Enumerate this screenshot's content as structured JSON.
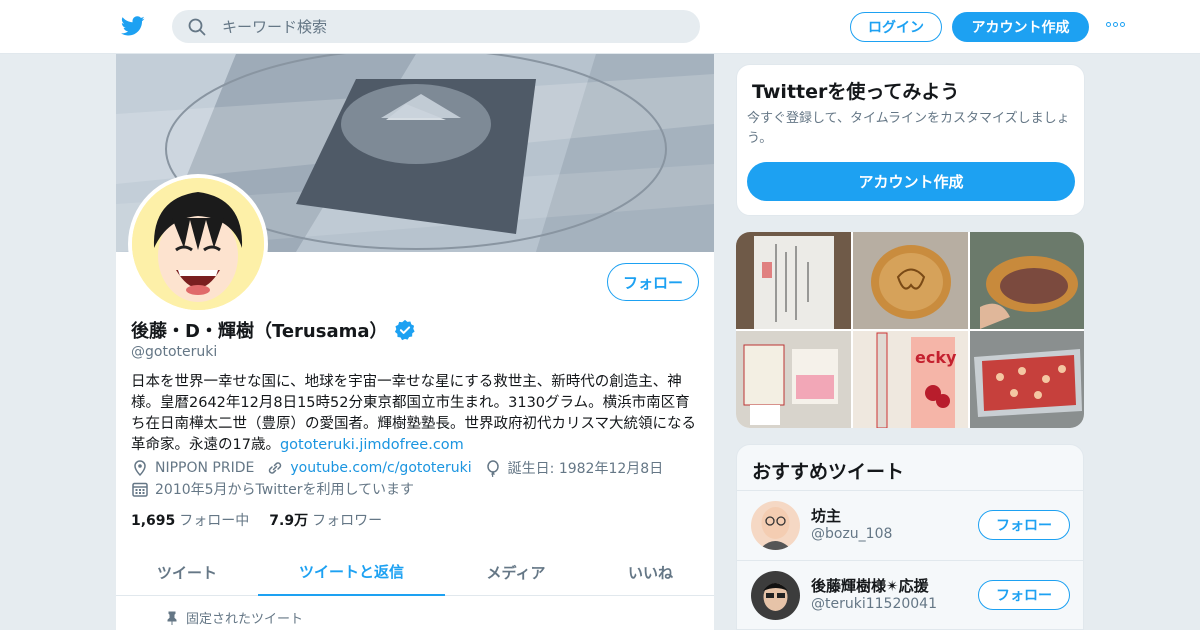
{
  "topbar": {
    "logo_icon": "twitter-bird-icon",
    "search_placeholder": "キーワード検索",
    "login_label": "ログイン",
    "signup_label": "アカウント作成",
    "more_icon": "more-dots-icon"
  },
  "profile": {
    "name": "後藤・D・輝樹（Terusama）",
    "handle": "@gototeruki",
    "follow_label": "フォロー",
    "bio_text": "日本を世界一幸せな国に、地球を宇宙一幸せな星にする救世主、新時代の創造主、神様。皇暦2642年12月8日15時52分東京都国立市生まれ。3130グラム。横浜市南区育ち在日南樺太二世（豊原）の愛国者。輝樹塾塾長。世界政府初代カリスマ大統領になる革命家。永遠の17歳。",
    "bio_link": "gototeruki.jimdofree.com",
    "location": "NIPPON PRIDE",
    "website": "youtube.com/c/gototeruki",
    "birthday": "誕生日: 1982年12月8日",
    "joined": "2010年5月からTwitterを利用しています",
    "following_count": "1,695",
    "following_label": "フォロー中",
    "followers_count": "7.9万",
    "followers_label": "フォロワー",
    "tabs": [
      {
        "label": "ツイート"
      },
      {
        "label": "ツイートと返信"
      },
      {
        "label": "メディア"
      },
      {
        "label": "いいね"
      }
    ],
    "active_tab": 1,
    "pinned_label": "固定されたツイート"
  },
  "signup_card": {
    "title": "Twitterを使ってみよう",
    "description": "今すぐ登録して、タイムラインをカスタマイズしましょう。",
    "button_label": "アカウント作成"
  },
  "recommendations": {
    "title": "おすすめツイート",
    "follow_label": "フォロー",
    "users": [
      {
        "name": "坊主",
        "handle": "@bozu_108"
      },
      {
        "name": "後藤輝樹様✴︎応援",
        "handle": "@teruki11520041"
      }
    ]
  },
  "colors": {
    "accent": "#1da1f2",
    "background": "#e6ecf0",
    "secondary_text": "#657786"
  }
}
